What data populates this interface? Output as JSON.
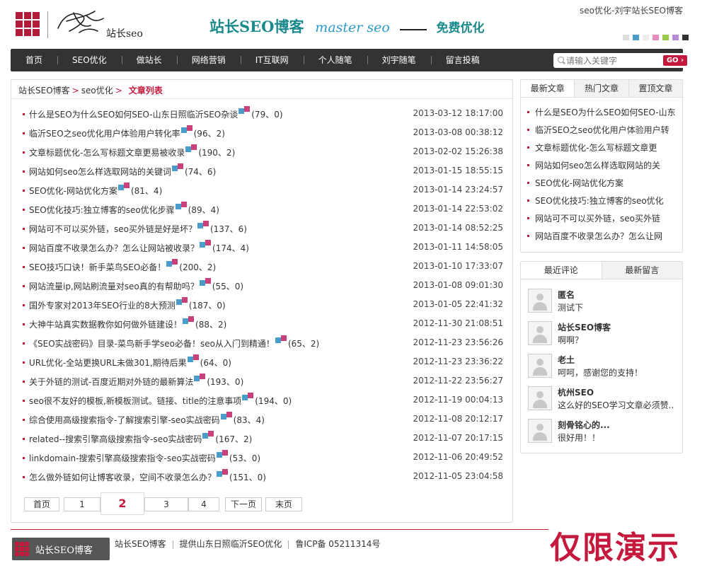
{
  "header": {
    "logo_text": "站长seo",
    "banner_cn": "站长SEO博客",
    "banner_en": "master seo",
    "banner_tag": "免费优化",
    "tagline": "seo优化-刘宇站长SEO博客",
    "swatches": [
      "#dddddd",
      "#4a9cc9",
      "#eeeeee",
      "#e58cc0",
      "#9ac94a",
      "#b78ad9",
      "#333333"
    ]
  },
  "nav": {
    "items": [
      "首页",
      "SEO优化",
      "做站长",
      "网络营销",
      "IT互联网",
      "个人随笔",
      "刘宇随笔",
      "留言投稿"
    ],
    "search_placeholder": "请输入关键字",
    "go_label": "GO ›"
  },
  "breadcrumb": {
    "home": "站长SEO博客",
    "arrow": ">",
    "category": "seo优化",
    "current": "文章列表"
  },
  "articles": [
    {
      "title": "什么是SEO为什么SEO如何SEO-山东日照临沂SEO杂谈",
      "counts": "(79、0)",
      "date": "2013-03-12 18:17:00"
    },
    {
      "title": "临沂SEO之seo优化用户体验用户转化率",
      "counts": "(96、2)",
      "date": "2013-03-08 00:38:12"
    },
    {
      "title": "文章标题优化-怎么写标题文章更易被收录",
      "counts": "(190、2)",
      "date": "2013-02-02 15:26:38"
    },
    {
      "title": "网站如何seo怎么样选取网站的关键词",
      "counts": "(74、6)",
      "date": "2013-01-15 18:55:15"
    },
    {
      "title": "SEO优化-网站优化方案",
      "counts": "(81、4)",
      "date": "2013-01-14 23:24:57"
    },
    {
      "title": "SEO优化技巧:独立博客的seo优化步骤",
      "counts": "(89、4)",
      "date": "2013-01-14 22:53:02"
    },
    {
      "title": "网站可不可以买外链，seo买外链是好是坏？",
      "counts": "(137、6)",
      "date": "2013-01-14 08:52:25"
    },
    {
      "title": "网站百度不收录怎么办？怎么让网站被收录？",
      "counts": "(174、4)",
      "date": "2013-01-11 14:58:05"
    },
    {
      "title": "SEO技巧口诀！新手菜鸟SEO必备！",
      "counts": "(200、2)",
      "date": "2013-01-10 17:33:07"
    },
    {
      "title": "网站流量ip,网站刷流量对seo真的有帮助吗？",
      "counts": "(55、0)",
      "date": "2013-01-08 09:01:30"
    },
    {
      "title": "国外专家对2013年SEO行业的8大预测",
      "counts": "(187、0)",
      "date": "2013-01-05 22:41:32"
    },
    {
      "title": "大神牛站真实数据教你如何做外链建设！",
      "counts": "(88、2)",
      "date": "2012-11-30 21:08:51"
    },
    {
      "title": "《SEO实战密码》目录-菜鸟新手学seo必备！seo从入门到精通！",
      "counts": "(65、2)",
      "date": "2012-11-23 23:56:26"
    },
    {
      "title": "URL优化-全站更换URL未做301,期待后果",
      "counts": "(64、0)",
      "date": "2012-11-23 23:36:22"
    },
    {
      "title": "关于外链的测试-百度近期对外链的最新算法",
      "counts": "(193、0)",
      "date": "2012-11-22 23:56:27"
    },
    {
      "title": "seo很不友好的模板,新模板测试。链接、title的注意事项",
      "counts": "(194、0)",
      "date": "2012-11-19 00:04:13"
    },
    {
      "title": "综合使用高级搜索指令-了解搜索引擎-seo实战密码",
      "counts": "(83、4)",
      "date": "2012-11-08 20:12:17"
    },
    {
      "title": "related--搜索引擎高级搜索指令-seo实战密码",
      "counts": "(167、2)",
      "date": "2012-11-07 20:17:15"
    },
    {
      "title": "linkdomain-搜索引擎高级搜索指令-seo实战密码",
      "counts": "(53、0)",
      "date": "2012-11-06 20:49:52"
    },
    {
      "title": "怎么做外链如何让博客收录，空间不收录怎么办？",
      "counts": "(151、0)",
      "date": "2012-11-05 23:04:58"
    }
  ],
  "pager": {
    "first": "首页",
    "pages": [
      "1",
      "2",
      "3",
      "4"
    ],
    "current_page": "2",
    "next": "下一页",
    "last": "末页"
  },
  "sidebar": {
    "tabs": [
      "最新文章",
      "热门文章",
      "置顶文章"
    ],
    "latest": [
      "SEO优化-网站优化方案",
      "SEO优化技巧:独立博客的seo优化",
      "网站可不可以买外链，seo买外链",
      "网站百度不收录怎么办？怎么让网"
    ],
    "latest_top": [
      "什么是SEO为什么SEO如何SEO-山东",
      "临沂SEO之seo优化用户体验用户转",
      "文章标题优化-怎么写标题文章更",
      "网站如何seo怎么样选取网站的关"
    ],
    "tabs2": [
      "最近评论",
      "最新留言"
    ],
    "comments": [
      {
        "name": "匿名",
        "text": "测试下"
      },
      {
        "name": "站长SEO博客",
        "text": "啊啊？"
      },
      {
        "name": "老土",
        "text": "呵呵，感谢您的支持！"
      },
      {
        "name": "杭州SEO",
        "text": "这么好的SEO学习文章必须赞..."
      },
      {
        "name": "刻骨铭心的...",
        "text": "很好用！！"
      }
    ]
  },
  "footer": {
    "logo_text": "站长SEO博客",
    "links": [
      "站长SEO博客",
      "提供山东日照临沂SEO优化",
      "鲁ICP备 05211314号"
    ],
    "watermark": "仅限演示"
  }
}
